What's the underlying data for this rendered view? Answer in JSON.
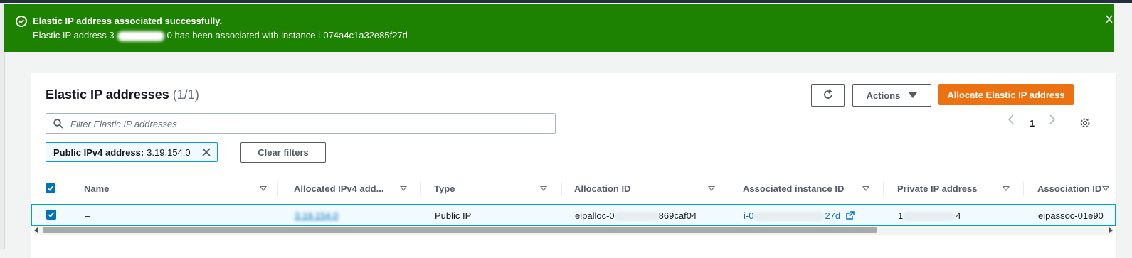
{
  "flash": {
    "title": "Elastic IP address associated successfully.",
    "message_prefix": "Elastic IP address 3",
    "message_suffix": "0 has been associated with instance i-074a4c1a32e85f27d",
    "dismiss_glyph": "X"
  },
  "panel": {
    "title": "Elastic IP addresses",
    "count": "(1/1)",
    "actions_label": "Actions",
    "allocate_label": "Allocate Elastic IP address",
    "search_placeholder": "Filter Elastic IP addresses",
    "page_number": "1",
    "filter_token_key": "Public IPv4 address:",
    "filter_token_value": "3.19.154.0",
    "clear_filters_label": "Clear filters"
  },
  "table": {
    "columns": [
      "Name",
      "Allocated IPv4 add...",
      "Type",
      "Allocation ID",
      "Associated instance ID",
      "Private IP address",
      "Association ID"
    ],
    "row": {
      "name": "–",
      "allocated_ip": "3.19.154.0",
      "type": "Public IP",
      "allocation_id_prefix": "eipalloc-0",
      "allocation_id_suffix": "869caf04",
      "instance_prefix": "i-0",
      "instance_suffix": "27d",
      "private_ip_prefix": "1",
      "private_ip_suffix": "4",
      "association_id": "eipassoc-01e90"
    }
  },
  "colors": {
    "success": "#1d8102",
    "primary": "#ec7211",
    "link": "#0073bb",
    "selected_border": "#00a1c9"
  },
  "icons": [
    "check-circle-icon",
    "close-icon",
    "refresh-icon",
    "caret-down-icon",
    "search-icon",
    "chevron-left-icon",
    "chevron-right-icon",
    "gear-icon",
    "external-link-icon"
  ]
}
